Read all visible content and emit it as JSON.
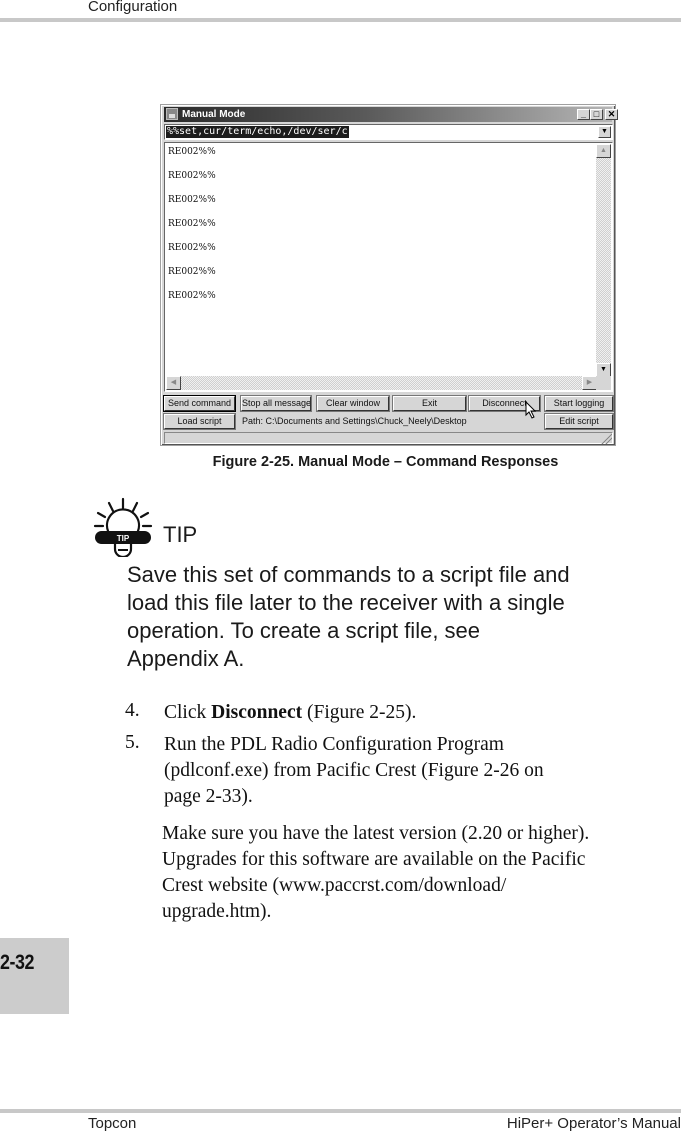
{
  "header": {
    "section": "Configuration"
  },
  "figure": {
    "window": {
      "title": "Manual Mode",
      "icon": "app-icon",
      "title_buttons": {
        "minimize": "_",
        "maximize": "□",
        "close": "✕"
      },
      "command_value": "%%set,cur/term/echo,/dev/ser/c",
      "command_dropdown_icon": "▼",
      "output_lines": [
        "RE002%%",
        "RE002%%",
        "RE002%%",
        "RE002%%",
        "RE002%%",
        "RE002%%",
        "RE002%%"
      ],
      "scroll_icons": {
        "up": "▲",
        "down": "▼",
        "left": "◀",
        "right": "▶"
      },
      "buttons_row1": [
        "Send command",
        "Stop all messages",
        "Clear window",
        "Exit",
        "Disconnect",
        "Start logging"
      ],
      "buttons_row2": {
        "load_script": "Load script",
        "edit_script": "Edit script"
      },
      "path_label": "Path:  C:\\Documents and Settings\\Chuck_Neely\\Desktop",
      "status_text": ""
    },
    "caption": "Figure 2-25. Manual Mode – Command Responses"
  },
  "tip": {
    "icon": "lightbulb-tip-icon",
    "icon_label": "TIP",
    "title": "TIP",
    "lines": [
      "Save this set of commands to a script file and",
      "load this file later to the receiver with a single",
      "operation. To create a script file, see",
      "Appendix A."
    ]
  },
  "steps": [
    {
      "number": "4.",
      "pre": "Click ",
      "bold": "Disconnect",
      "post": " (Figure 2-25)."
    },
    {
      "number": "5.",
      "lines": [
        "Run the PDL Radio Configuration Program",
        "(pdlconf.exe) from Pacific Crest (Figure 2-26 on",
        "page 2-33)."
      ]
    }
  ],
  "note_lines": [
    "Make sure you have the latest version (2.20 or higher).",
    "Upgrades for this software are available on the Pacific",
    "Crest website (www.paccrst.com/download/",
    "upgrade.htm)."
  ],
  "page_tab": {
    "page_number": "2-32"
  },
  "footer": {
    "left": "Topcon",
    "right": "HiPer+ Operator’s Manual"
  }
}
